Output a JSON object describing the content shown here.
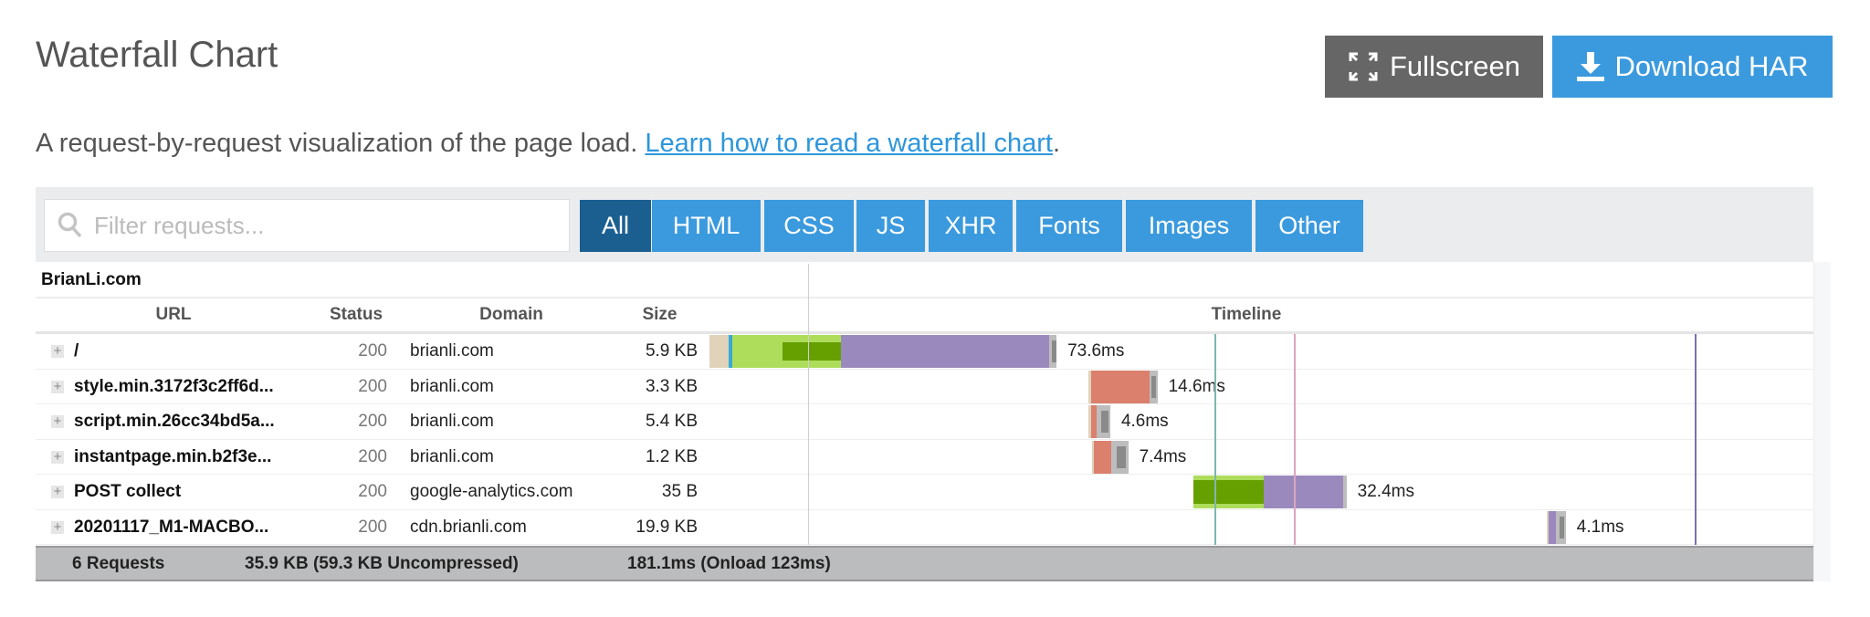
{
  "header": {
    "title": "Waterfall Chart",
    "fullscreen_label": "Fullscreen",
    "download_label": "Download HAR",
    "subtitle": "A request-by-request visualization of the page load. ",
    "learn_link": "Learn how to read a waterfall chart",
    "subtitle_end": "."
  },
  "filter": {
    "placeholder": "Filter requests...",
    "value": "",
    "icon": "search-icon"
  },
  "tabs": [
    {
      "label": "All",
      "active": true
    },
    {
      "label": "HTML"
    },
    {
      "label": "CSS"
    },
    {
      "label": "JS"
    },
    {
      "label": "XHR"
    },
    {
      "label": "Fonts"
    },
    {
      "label": "Images"
    },
    {
      "label": "Other"
    }
  ],
  "site": "BrianLi.com",
  "columns": {
    "url": "URL",
    "status": "Status",
    "domain": "Domain",
    "size": "Size",
    "timeline": "Timeline"
  },
  "rows": [
    {
      "url": "/",
      "status": "200",
      "domain": "brianli.com",
      "size": "5.9 KB",
      "duration": "73.6ms",
      "segments": [
        [
          "blocked",
          0,
          4.0
        ],
        [
          "dns",
          4.0,
          4.8
        ],
        [
          "connect",
          4.8,
          27.8
        ],
        [
          "ssl",
          15.4,
          27.8
        ],
        [
          "wait",
          27.8,
          72.1
        ],
        [
          "receive",
          72.1,
          73.6
        ]
      ]
    },
    {
      "url": "style.min.3172f3c2ff6d...",
      "status": "200",
      "domain": "brianli.com",
      "size": "3.3 KB",
      "duration": "14.6ms",
      "segments": [
        [
          "blocked",
          80.4,
          80.9
        ],
        [
          "salmon",
          80.9,
          93.3
        ],
        [
          "receive",
          93.3,
          95.0
        ]
      ]
    },
    {
      "url": "script.min.26cc34bd5a...",
      "status": "200",
      "domain": "brianli.com",
      "size": "5.4 KB",
      "duration": "4.6ms",
      "segments": [
        [
          "blocked",
          80.4,
          80.9
        ],
        [
          "salmon",
          80.9,
          82.2
        ],
        [
          "receive",
          82.2,
          85.0
        ]
      ]
    },
    {
      "url": "instantpage.min.b2f3e...",
      "status": "200",
      "domain": "brianli.com",
      "size": "1.2 KB",
      "duration": "7.4ms",
      "segments": [
        [
          "blocked",
          81.2,
          81.6
        ],
        [
          "salmon",
          81.6,
          85.2
        ],
        [
          "receive",
          85.2,
          88.8
        ]
      ]
    },
    {
      "url": "POST collect",
      "status": "200",
      "domain": "google-analytics.com",
      "size": "35 B",
      "duration": "32.4ms",
      "segments": [
        [
          "connect",
          102.7,
          117.6
        ],
        [
          "ssl-tall",
          102.7,
          117.6
        ],
        [
          "wait",
          117.6,
          134.3
        ],
        [
          "receive",
          134.3,
          135.1
        ]
      ]
    },
    {
      "url": "20201117_M1-MACBO...",
      "status": "200",
      "domain": "cdn.brianli.com",
      "size": "19.9 KB",
      "duration": "4.1ms",
      "segments": [
        [
          "blocked",
          177.5,
          178.0
        ],
        [
          "wait",
          178.0,
          179.6
        ],
        [
          "receive",
          179.6,
          181.6
        ]
      ]
    }
  ],
  "markers_ms": [
    {
      "ms": 21,
      "color": "#cfcfcf"
    },
    {
      "ms": 107,
      "color": "#7fb7b0"
    },
    {
      "ms": 124,
      "color": "#d9a6bd"
    },
    {
      "ms": 209,
      "color": "#7b70aa"
    }
  ],
  "footer": {
    "requests": "6 Requests",
    "size": "35.9 KB  (59.3 KB Uncompressed)",
    "time": "181.1ms  (Onload 123ms)"
  },
  "colors": {
    "blocked": "#e0d3b9",
    "dns": "#3aa9d6",
    "connect": "#aedd5c",
    "ssl": "#66a000",
    "wait": "#9a89bd",
    "receive": "#bdbdbd",
    "receive_inner": "#8a8a8a",
    "salmon": "#db806c",
    "tab": "#3b9ade",
    "tab_active": "#1b5f91",
    "download": "#3b9ade",
    "fullscreen": "#666666"
  }
}
